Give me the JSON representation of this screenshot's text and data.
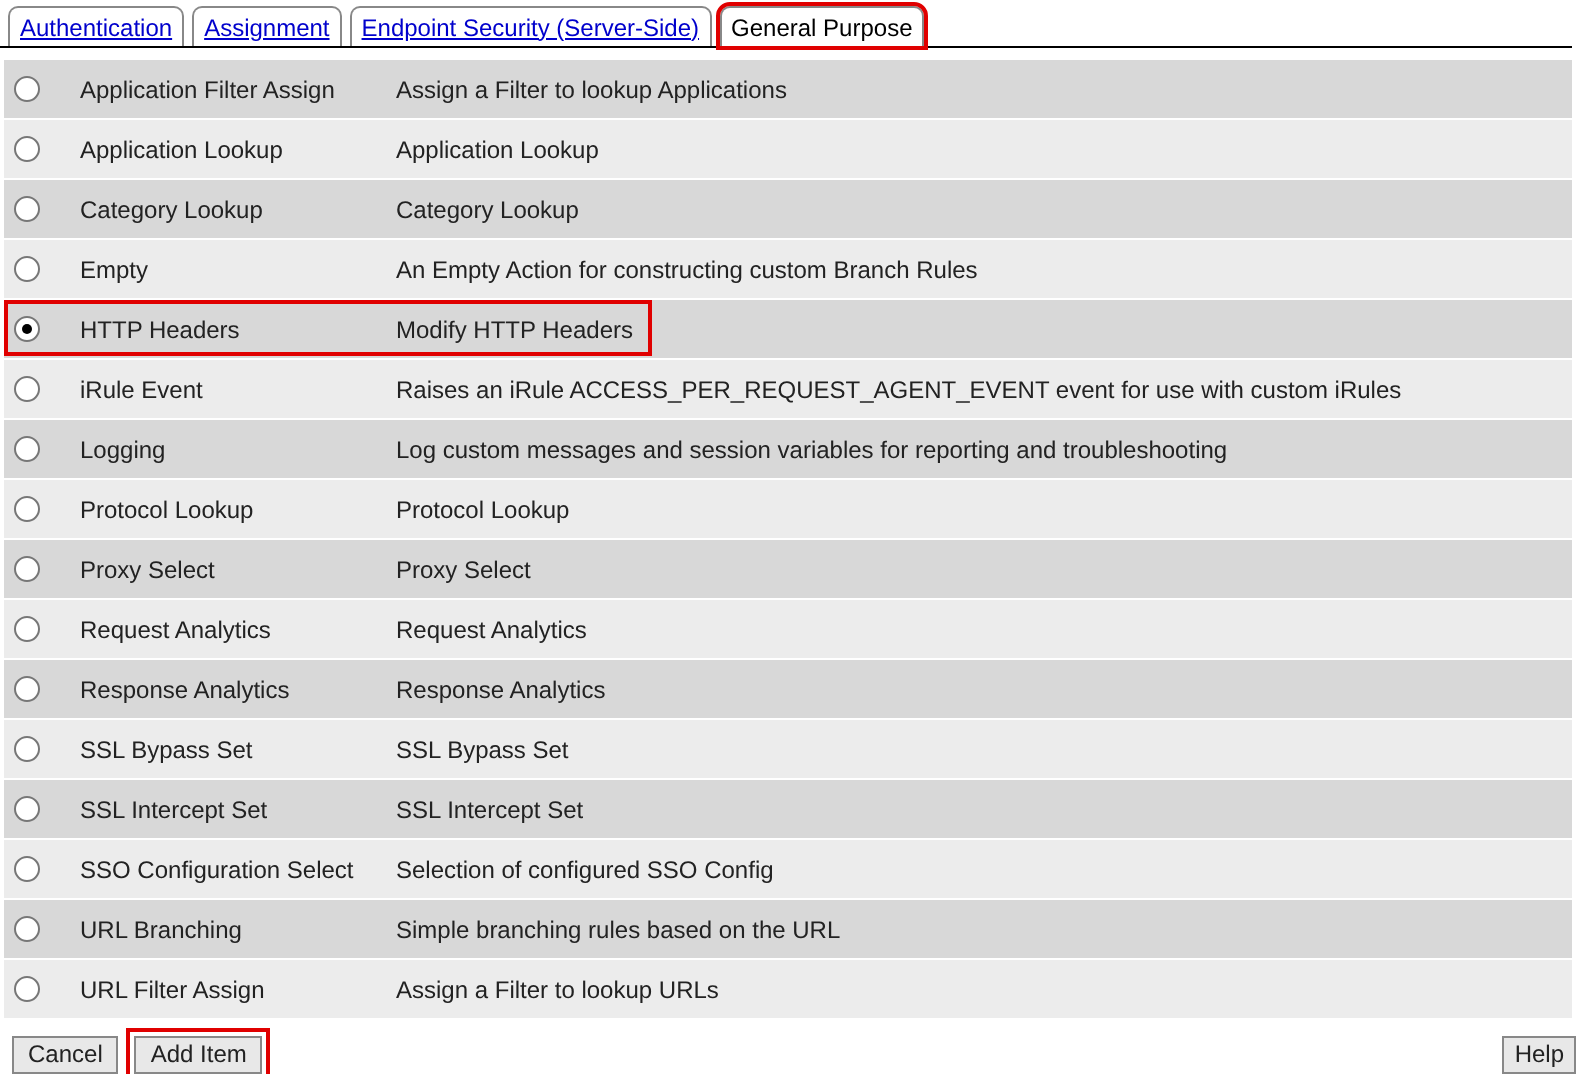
{
  "tabs": [
    {
      "label": "Authentication",
      "selected": false,
      "highlighted": false
    },
    {
      "label": "Assignment",
      "selected": false,
      "highlighted": false
    },
    {
      "label": "Endpoint Security (Server-Side)",
      "selected": false,
      "highlighted": false
    },
    {
      "label": "General Purpose",
      "selected": true,
      "highlighted": true
    }
  ],
  "items": [
    {
      "name": "Application Filter Assign",
      "description": "Assign a Filter to lookup Applications",
      "selected": false,
      "highlighted": false
    },
    {
      "name": "Application Lookup",
      "description": "Application Lookup",
      "selected": false,
      "highlighted": false
    },
    {
      "name": "Category Lookup",
      "description": "Category Lookup",
      "selected": false,
      "highlighted": false
    },
    {
      "name": "Empty",
      "description": "An Empty Action for constructing custom Branch Rules",
      "selected": false,
      "highlighted": false
    },
    {
      "name": "HTTP Headers",
      "description": "Modify HTTP Headers",
      "selected": true,
      "highlighted": true
    },
    {
      "name": "iRule Event",
      "description": "Raises an iRule ACCESS_PER_REQUEST_AGENT_EVENT event for use with custom iRules",
      "selected": false,
      "highlighted": false
    },
    {
      "name": "Logging",
      "description": "Log custom messages and session variables for reporting and troubleshooting",
      "selected": false,
      "highlighted": false
    },
    {
      "name": "Protocol Lookup",
      "description": "Protocol Lookup",
      "selected": false,
      "highlighted": false
    },
    {
      "name": "Proxy Select",
      "description": "Proxy Select",
      "selected": false,
      "highlighted": false
    },
    {
      "name": "Request Analytics",
      "description": "Request Analytics",
      "selected": false,
      "highlighted": false
    },
    {
      "name": "Response Analytics",
      "description": "Response Analytics",
      "selected": false,
      "highlighted": false
    },
    {
      "name": "SSL Bypass Set",
      "description": "SSL Bypass Set",
      "selected": false,
      "highlighted": false
    },
    {
      "name": "SSL Intercept Set",
      "description": "SSL Intercept Set",
      "selected": false,
      "highlighted": false
    },
    {
      "name": "SSO Configuration Select",
      "description": "Selection of configured SSO Config",
      "selected": false,
      "highlighted": false
    },
    {
      "name": "URL Branching",
      "description": "Simple branching rules based on the URL",
      "selected": false,
      "highlighted": false
    },
    {
      "name": "URL Filter Assign",
      "description": "Assign a Filter to lookup URLs",
      "selected": false,
      "highlighted": false
    }
  ],
  "buttons": [
    {
      "label": "Cancel",
      "highlighted": false
    },
    {
      "label": "Add Item",
      "highlighted": true
    }
  ],
  "help_button": {
    "label": "Help"
  }
}
